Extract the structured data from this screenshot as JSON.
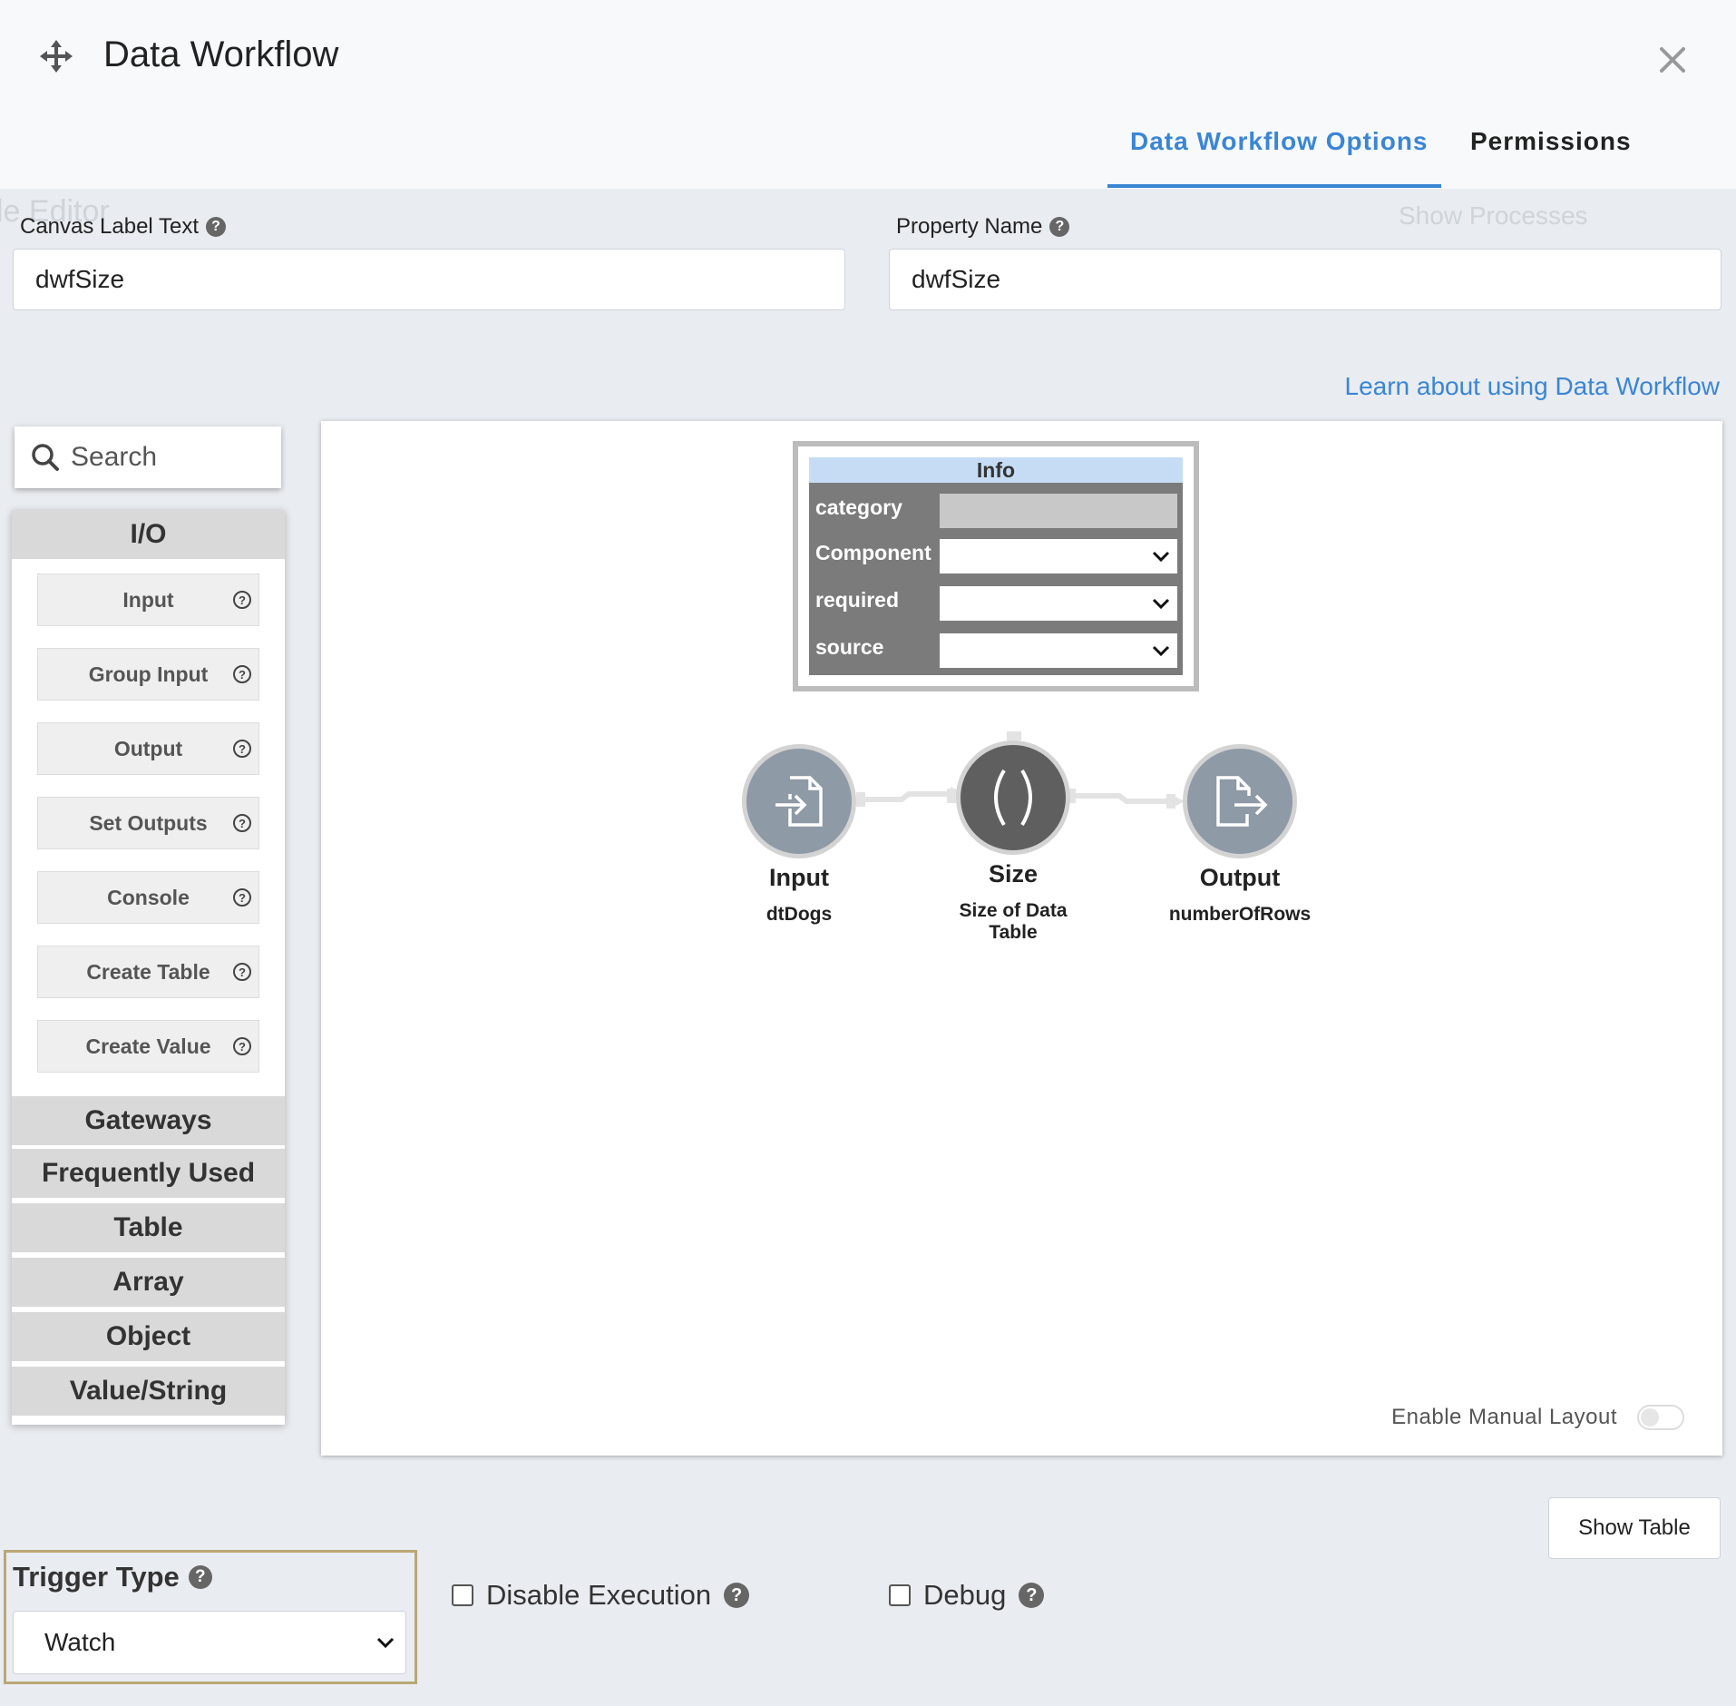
{
  "header": {
    "title": "Data Workflow",
    "tabs": [
      {
        "label": "Data Workflow Options",
        "active": true
      },
      {
        "label": "Permissions",
        "active": false
      }
    ]
  },
  "background_ghost": {
    "editor_label": "le Editor",
    "show_processes": "Show Processes"
  },
  "form": {
    "canvas_label": {
      "label": "Canvas Label Text",
      "value": "dwfSize"
    },
    "property_name": {
      "label": "Property Name",
      "value": "dwfSize"
    },
    "help_glyph": "?"
  },
  "learn_link": "Learn about using Data Workflow",
  "sidebar": {
    "search_placeholder": "Search",
    "category": "I/O",
    "items": [
      "Input",
      "Group Input",
      "Output",
      "Set Outputs",
      "Console",
      "Create Table",
      "Create Value"
    ],
    "item_info_glyph": "?",
    "categories": [
      "Gateways",
      "Frequently Used",
      "Table",
      "Array",
      "Object",
      "Value/String"
    ]
  },
  "canvas": {
    "info_card": {
      "title": "Info",
      "fields": [
        {
          "label": "category",
          "type": "disabled"
        },
        {
          "label": "Component",
          "type": "select"
        },
        {
          "label": "required",
          "type": "select"
        },
        {
          "label": "source",
          "type": "select"
        }
      ]
    },
    "nodes": [
      {
        "title": "Input",
        "subtitle": "dtDogs",
        "icon": "file-import-icon",
        "color": "#8e9aa6"
      },
      {
        "title": "Size",
        "subtitle": "Size of Data Table",
        "icon": "parentheses-icon",
        "color": "#5f5f5f"
      },
      {
        "title": "Output",
        "subtitle": "numberOfRows",
        "icon": "file-export-icon",
        "color": "#8e9aa6"
      }
    ],
    "manual_layout_label": "Enable Manual Layout",
    "manual_layout_on": false
  },
  "show_table_label": "Show Table",
  "trigger": {
    "label": "Trigger Type",
    "value": "Watch"
  },
  "checkboxes": {
    "disable_execution": {
      "label": "Disable Execution",
      "checked": false
    },
    "debug": {
      "label": "Debug",
      "checked": false
    }
  },
  "colors": {
    "accent": "#3a86d4",
    "trigger_highlight": "#b9a775"
  }
}
